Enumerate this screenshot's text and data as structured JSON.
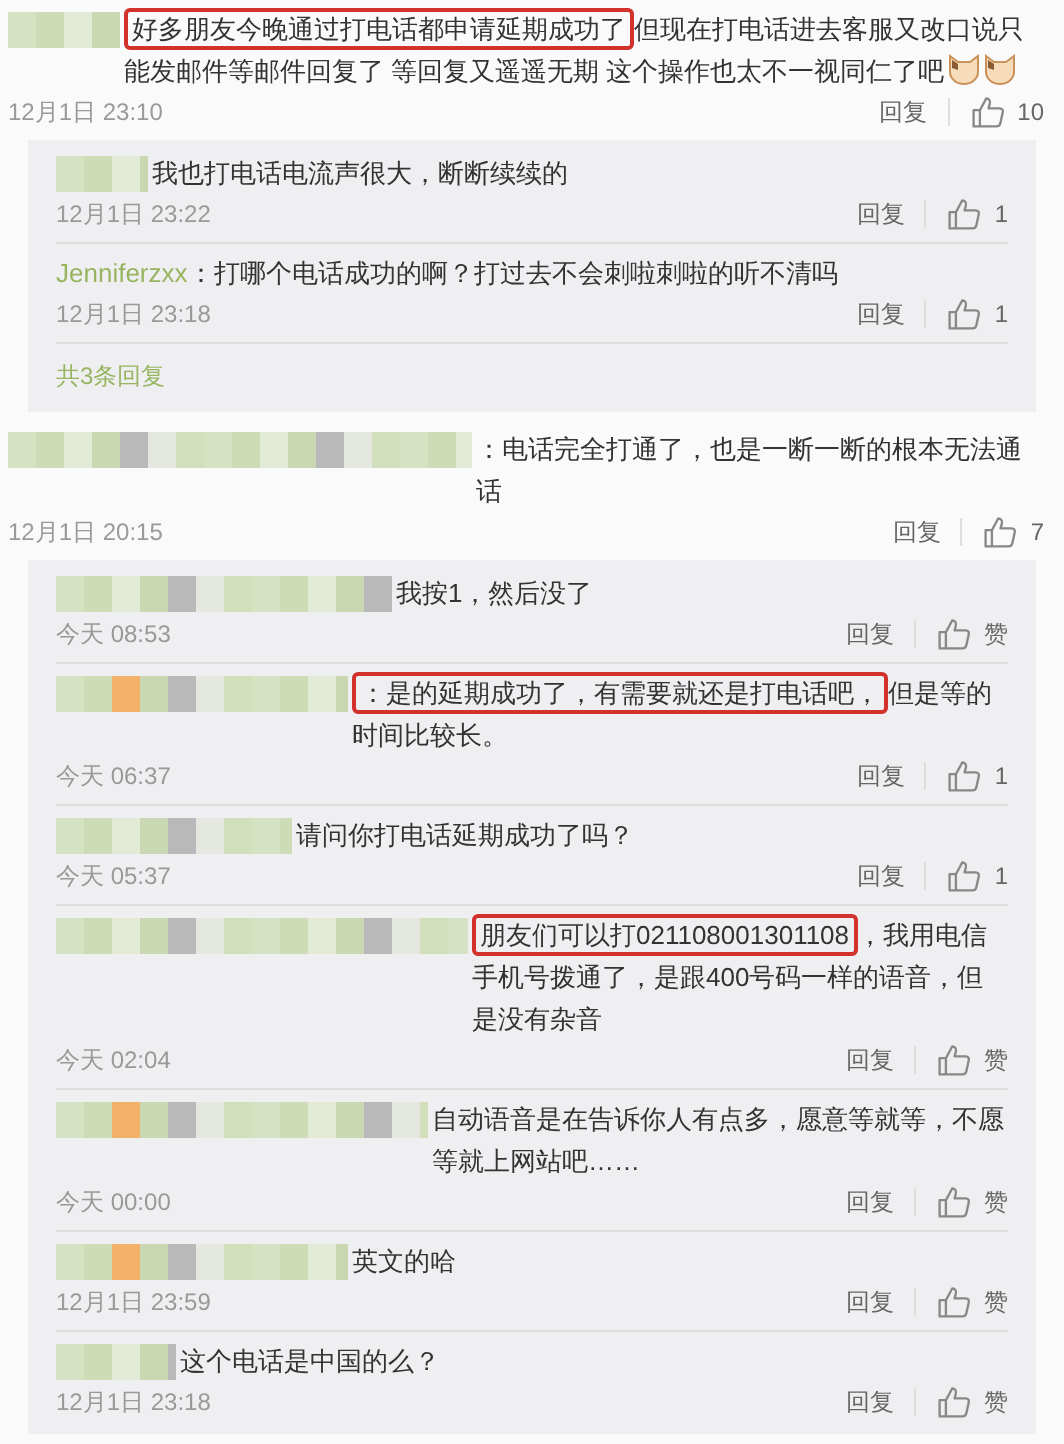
{
  "threads": [
    {
      "comment": {
        "highlight": "好多朋友今晚通过打电话都申请延期成功了",
        "text": "但现在打电话进去客服又改口说只能发邮件等邮件回复了 等回复又遥遥无期 这个操作也太不一视同仁了吧",
        "emojis": [
          {
            "kind": "cat"
          },
          {
            "kind": "cat"
          }
        ],
        "date": "12月1日 23:10",
        "reply": "回复",
        "likes": "10"
      },
      "replies": [
        {
          "text": "我也打电话电流声很大，断断续续的",
          "date": "12月1日 23:22",
          "reply": "回复",
          "likes": "1"
        },
        {
          "name": "Jenniferzxx",
          "text": "：打哪个电话成功的啊？打过去不会刺啦刺啦的听不清吗",
          "date": "12月1日 23:18",
          "reply": "回复",
          "likes": "1"
        }
      ],
      "more": "共3条回复"
    },
    {
      "comment": {
        "text": "：电话完全打通了，也是一断一断的根本无法通话",
        "date": "12月1日 20:15",
        "reply": "回复",
        "likes": "7"
      },
      "replies": [
        {
          "text": "我按1，然后没了",
          "date": "今天 08:53",
          "reply": "回复",
          "likes": "赞"
        },
        {
          "highlight": "：是的延期成功了，有需要就还是打电话吧，",
          "text": "但是等的时间比较长。",
          "date": "今天 06:37",
          "reply": "回复",
          "likes": "1"
        },
        {
          "text": "请问你打电话延期成功了吗？",
          "date": "今天 05:37",
          "reply": "回复",
          "likes": "1"
        },
        {
          "highlight": "朋友们可以打021108001301108",
          "text": "，我用电信手机号拨通了，是跟400号码一样的语音，但是没有杂音",
          "date": "今天 02:04",
          "reply": "回复",
          "likes": "赞"
        },
        {
          "text": "自动语音是在告诉你人有点多，愿意等就等，不愿等就上网站吧……",
          "date": "今天 00:00",
          "reply": "回复",
          "likes": "赞"
        },
        {
          "text": "英文的哈",
          "date": "12月1日 23:59",
          "reply": "回复",
          "likes": "赞"
        },
        {
          "text": "这个电话是中国的么？",
          "date": "12月1日 23:18",
          "reply": "回复",
          "likes": "赞"
        }
      ]
    }
  ]
}
